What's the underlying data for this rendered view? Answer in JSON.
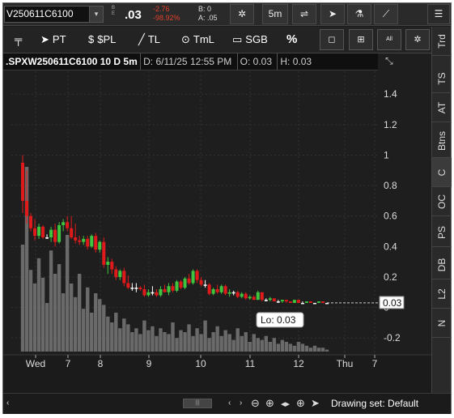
{
  "toolbar": {
    "symbol": "V250611C6100",
    "dropdown": "▾",
    "exchange_label": "B\nE",
    "last_price": ".03",
    "net_change": "-2.76",
    "pct_change": "-98.92%",
    "bid": "B: 0",
    "ask": "A: .05",
    "interval_label": "5m",
    "menu_label": "☰"
  },
  "drawing_tools": {
    "pin": "📌",
    "pt_label": "PT",
    "spl_label": "$PL",
    "tl_label": "TL",
    "tml_label": "TmL",
    "sgb_label": "SGB",
    "pct_label": "%",
    "all_label": "All"
  },
  "right_tabs": [
    "Trd",
    "TS",
    "AT",
    "Btns",
    "C",
    "OC",
    "PS",
    "DB",
    "L2",
    "N"
  ],
  "info_bar": {
    "title": ".SPXW250611C6100 10 D 5m",
    "date": "D: 6/11/25 12:55 PM",
    "open": "O: 0.03",
    "high": "H: 0.03"
  },
  "chart_data": {
    "type": "candlestick",
    "y_ticks": [
      "1.4",
      "1.2",
      "1",
      "0.8",
      "0.6",
      "0.4",
      "0.2",
      "0",
      "-0.2"
    ],
    "y_range": [
      -0.3,
      1.55
    ],
    "x_labels": [
      "Wed",
      "7",
      "8",
      "9",
      "10",
      "11",
      "12",
      "Thu",
      "7"
    ],
    "last_price_label": "0.03",
    "low_annotation": "Lo: 0.03",
    "colors": {
      "up": "#3ec43e",
      "down": "#e01a1a",
      "neutral": "#ffffff",
      "volume": "#6a6a6a",
      "grid": "#333333"
    },
    "candles": [
      {
        "o": 0.95,
        "h": 1.0,
        "l": 0.62,
        "c": 0.7
      },
      {
        "o": 0.7,
        "h": 0.9,
        "l": 0.55,
        "c": 0.6
      },
      {
        "o": 0.6,
        "h": 0.62,
        "l": 0.5,
        "c": 0.52
      },
      {
        "o": 0.52,
        "h": 0.58,
        "l": 0.44,
        "c": 0.47
      },
      {
        "o": 0.47,
        "h": 0.55,
        "l": 0.45,
        "c": 0.53
      },
      {
        "o": 0.53,
        "h": 0.54,
        "l": 0.45,
        "c": 0.46
      },
      {
        "o": 0.46,
        "h": 0.48,
        "l": 0.45,
        "c": 0.46
      },
      {
        "o": 0.46,
        "h": 0.53,
        "l": 0.43,
        "c": 0.51
      },
      {
        "o": 0.51,
        "h": 0.55,
        "l": 0.4,
        "c": 0.43
      },
      {
        "o": 0.43,
        "h": 0.56,
        "l": 0.42,
        "c": 0.54
      },
      {
        "o": 0.54,
        "h": 0.58,
        "l": 0.5,
        "c": 0.56
      },
      {
        "o": 0.56,
        "h": 0.6,
        "l": 0.5,
        "c": 0.52
      },
      {
        "o": 0.52,
        "h": 0.6,
        "l": 0.45,
        "c": 0.46
      },
      {
        "o": 0.46,
        "h": 0.55,
        "l": 0.42,
        "c": 0.44
      },
      {
        "o": 0.44,
        "h": 0.47,
        "l": 0.41,
        "c": 0.43
      },
      {
        "o": 0.43,
        "h": 0.47,
        "l": 0.41,
        "c": 0.45
      },
      {
        "o": 0.45,
        "h": 0.47,
        "l": 0.38,
        "c": 0.4
      },
      {
        "o": 0.4,
        "h": 0.48,
        "l": 0.39,
        "c": 0.47
      },
      {
        "o": 0.47,
        "h": 0.49,
        "l": 0.36,
        "c": 0.38
      },
      {
        "o": 0.38,
        "h": 0.44,
        "l": 0.36,
        "c": 0.43
      },
      {
        "o": 0.43,
        "h": 0.46,
        "l": 0.26,
        "c": 0.28
      },
      {
        "o": 0.28,
        "h": 0.33,
        "l": 0.22,
        "c": 0.3
      },
      {
        "o": 0.3,
        "h": 0.32,
        "l": 0.22,
        "c": 0.25
      },
      {
        "o": 0.25,
        "h": 0.27,
        "l": 0.18,
        "c": 0.2
      },
      {
        "o": 0.2,
        "h": 0.25,
        "l": 0.18,
        "c": 0.24
      },
      {
        "o": 0.24,
        "h": 0.26,
        "l": 0.14,
        "c": 0.16
      },
      {
        "o": 0.16,
        "h": 0.21,
        "l": 0.12,
        "c": 0.13
      },
      {
        "o": 0.13,
        "h": 0.16,
        "l": 0.11,
        "c": 0.13
      },
      {
        "o": 0.13,
        "h": 0.16,
        "l": 0.1,
        "c": 0.13
      },
      {
        "o": 0.13,
        "h": 0.14,
        "l": 0.11,
        "c": 0.12
      },
      {
        "o": 0.12,
        "h": 0.15,
        "l": 0.07,
        "c": 0.08
      },
      {
        "o": 0.08,
        "h": 0.12,
        "l": 0.07,
        "c": 0.1
      },
      {
        "o": 0.1,
        "h": 0.14,
        "l": 0.08,
        "c": 0.1
      },
      {
        "o": 0.1,
        "h": 0.12,
        "l": 0.07,
        "c": 0.08
      },
      {
        "o": 0.08,
        "h": 0.14,
        "l": 0.07,
        "c": 0.12
      },
      {
        "o": 0.12,
        "h": 0.15,
        "l": 0.1,
        "c": 0.1
      },
      {
        "o": 0.1,
        "h": 0.16,
        "l": 0.08,
        "c": 0.14
      },
      {
        "o": 0.14,
        "h": 0.16,
        "l": 0.1,
        "c": 0.11
      },
      {
        "o": 0.11,
        "h": 0.18,
        "l": 0.1,
        "c": 0.17
      },
      {
        "o": 0.17,
        "h": 0.18,
        "l": 0.12,
        "c": 0.13
      },
      {
        "o": 0.13,
        "h": 0.2,
        "l": 0.12,
        "c": 0.19
      },
      {
        "o": 0.19,
        "h": 0.22,
        "l": 0.15,
        "c": 0.16
      },
      {
        "o": 0.16,
        "h": 0.25,
        "l": 0.15,
        "c": 0.24
      },
      {
        "o": 0.24,
        "h": 0.25,
        "l": 0.16,
        "c": 0.18
      },
      {
        "o": 0.18,
        "h": 0.2,
        "l": 0.14,
        "c": 0.15
      },
      {
        "o": 0.15,
        "h": 0.18,
        "l": 0.13,
        "c": 0.15
      },
      {
        "o": 0.15,
        "h": 0.16,
        "l": 0.08,
        "c": 0.09
      },
      {
        "o": 0.09,
        "h": 0.13,
        "l": 0.08,
        "c": 0.12
      },
      {
        "o": 0.12,
        "h": 0.15,
        "l": 0.09,
        "c": 0.1
      },
      {
        "o": 0.1,
        "h": 0.15,
        "l": 0.09,
        "c": 0.14
      },
      {
        "o": 0.14,
        "h": 0.15,
        "l": 0.08,
        "c": 0.09
      },
      {
        "o": 0.09,
        "h": 0.12,
        "l": 0.07,
        "c": 0.1
      },
      {
        "o": 0.1,
        "h": 0.11,
        "l": 0.08,
        "c": 0.1
      },
      {
        "o": 0.1,
        "h": 0.11,
        "l": 0.06,
        "c": 0.07
      },
      {
        "o": 0.07,
        "h": 0.1,
        "l": 0.06,
        "c": 0.09
      },
      {
        "o": 0.09,
        "h": 0.1,
        "l": 0.05,
        "c": 0.06
      },
      {
        "o": 0.06,
        "h": 0.08,
        "l": 0.05,
        "c": 0.07
      },
      {
        "o": 0.07,
        "h": 0.08,
        "l": 0.05,
        "c": 0.05
      },
      {
        "o": 0.05,
        "h": 0.11,
        "l": 0.05,
        "c": 0.1
      },
      {
        "o": 0.1,
        "h": 0.1,
        "l": 0.04,
        "c": 0.05
      },
      {
        "o": 0.05,
        "h": 0.06,
        "l": 0.04,
        "c": 0.05
      },
      {
        "o": 0.05,
        "h": 0.07,
        "l": 0.04,
        "c": 0.06
      },
      {
        "o": 0.06,
        "h": 0.06,
        "l": 0.04,
        "c": 0.04
      },
      {
        "o": 0.04,
        "h": 0.05,
        "l": 0.03,
        "c": 0.04
      },
      {
        "o": 0.04,
        "h": 0.05,
        "l": 0.03,
        "c": 0.05
      },
      {
        "o": 0.05,
        "h": 0.05,
        "l": 0.03,
        "c": 0.04
      },
      {
        "o": 0.04,
        "h": 0.04,
        "l": 0.03,
        "c": 0.03
      },
      {
        "o": 0.03,
        "h": 0.05,
        "l": 0.03,
        "c": 0.05
      },
      {
        "o": 0.05,
        "h": 0.05,
        "l": 0.03,
        "c": 0.03
      },
      {
        "o": 0.03,
        "h": 0.04,
        "l": 0.03,
        "c": 0.03
      },
      {
        "o": 0.03,
        "h": 0.04,
        "l": 0.03,
        "c": 0.04
      },
      {
        "o": 0.04,
        "h": 0.04,
        "l": 0.03,
        "c": 0.03
      },
      {
        "o": 0.03,
        "h": 0.03,
        "l": 0.03,
        "c": 0.03
      },
      {
        "o": 0.03,
        "h": 0.04,
        "l": 0.03,
        "c": 0.04
      },
      {
        "o": 0.04,
        "h": 0.04,
        "l": 0.03,
        "c": 0.03
      },
      {
        "o": 0.03,
        "h": 0.03,
        "l": 0.03,
        "c": 0.03
      }
    ],
    "volume": [
      0.55,
      0.95,
      0.42,
      0.35,
      0.48,
      0.38,
      0.25,
      0.52,
      0.4,
      0.45,
      0.3,
      0.6,
      0.35,
      0.28,
      0.4,
      0.22,
      0.33,
      0.2,
      0.3,
      0.27,
      0.24,
      0.18,
      0.15,
      0.2,
      0.12,
      0.17,
      0.14,
      0.1,
      0.12,
      0.09,
      0.16,
      0.11,
      0.13,
      0.08,
      0.12,
      0.1,
      0.09,
      0.15,
      0.07,
      0.11,
      0.1,
      0.14,
      0.08,
      0.12,
      0.09,
      0.16,
      0.07,
      0.1,
      0.13,
      0.08,
      0.11,
      0.09,
      0.06,
      0.12,
      0.08,
      0.1,
      0.05,
      0.09,
      0.07,
      0.06,
      0.08,
      0.05,
      0.07,
      0.04,
      0.06,
      0.05,
      0.04,
      0.03,
      0.05,
      0.04,
      0.03,
      0.02,
      0.03,
      0.02,
      0.02,
      0.01
    ]
  },
  "bottom": {
    "scroll_thumb": "|||",
    "drawing_set": "Drawing set: Default"
  }
}
